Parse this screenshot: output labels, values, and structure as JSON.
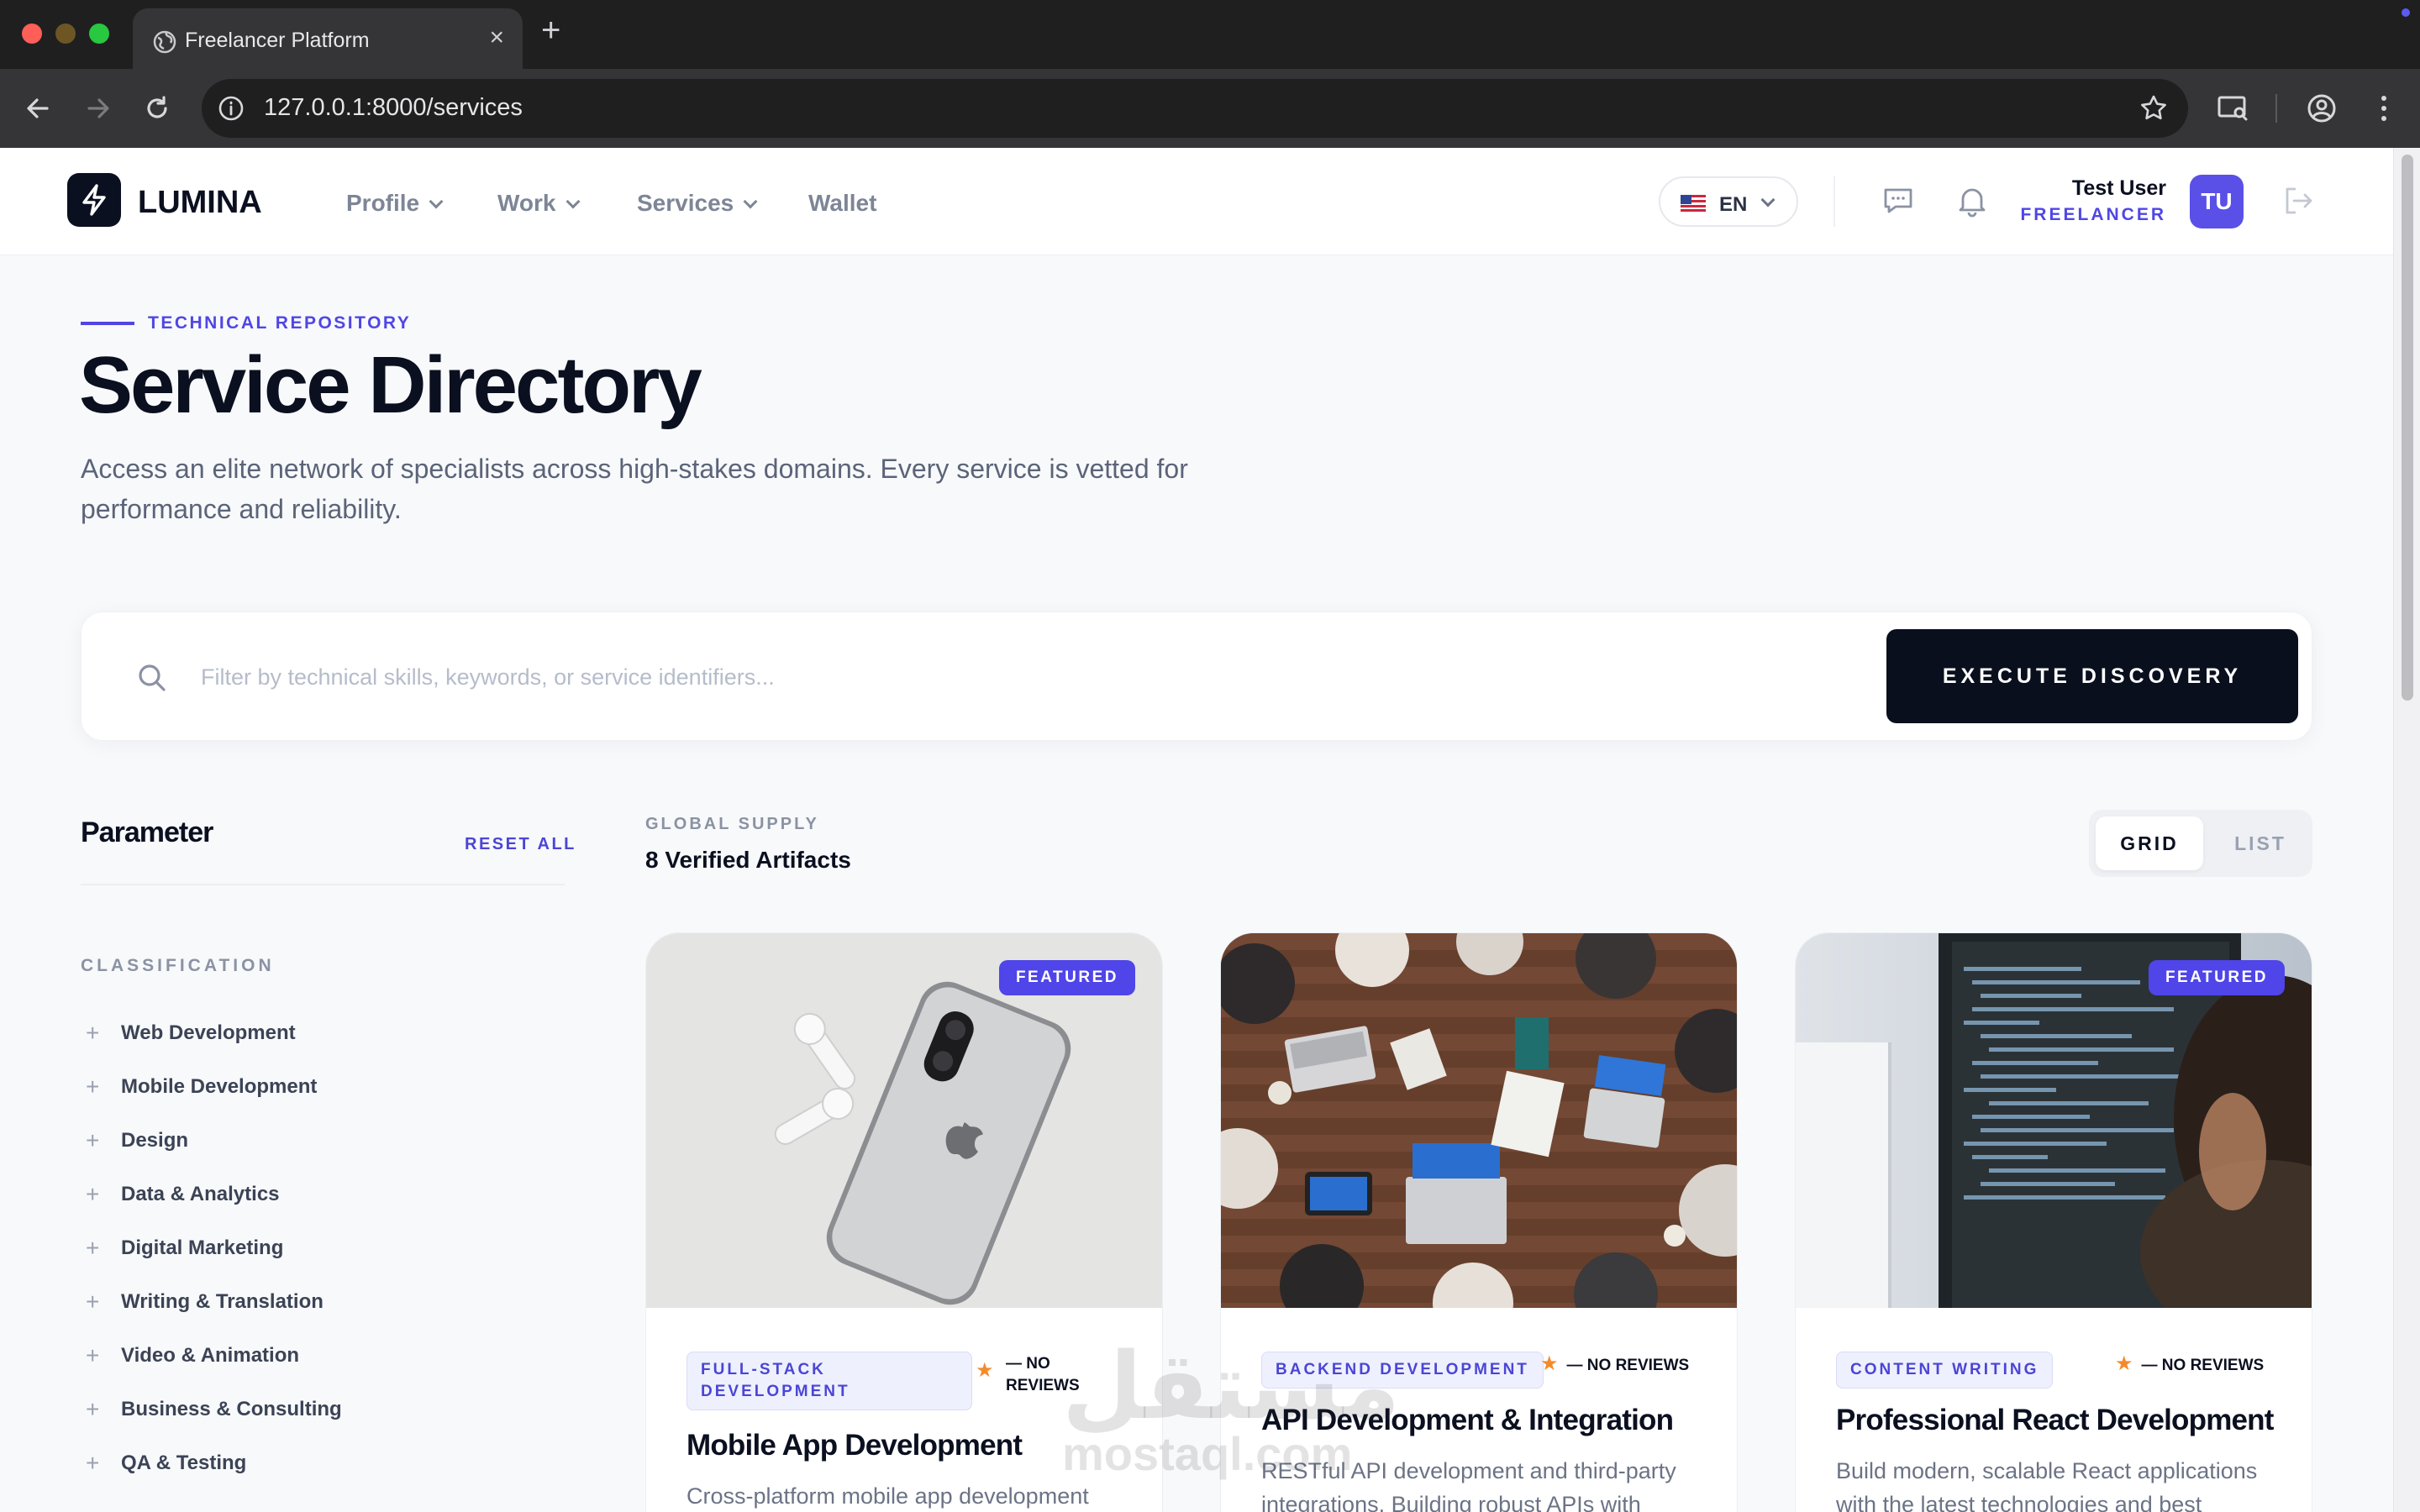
{
  "browser": {
    "tab_title": "Freelancer Platform",
    "url": "127.0.0.1:8000/services",
    "new_tab_label": "+",
    "close_label": "×"
  },
  "header": {
    "logo": "LUMINA",
    "nav": [
      {
        "label": "Profile",
        "has_menu": true
      },
      {
        "label": "Work",
        "has_menu": true
      },
      {
        "label": "Services",
        "has_menu": true
      },
      {
        "label": "Wallet",
        "has_menu": false
      }
    ],
    "language": "EN",
    "user": {
      "name": "Test User",
      "role": "FREELANCER",
      "initials": "TU"
    }
  },
  "hero": {
    "eyebrow": "TECHNICAL REPOSITORY",
    "title": "Service Directory",
    "description": "Access an elite network of specialists across high-stakes domains. Every service is vetted for performance and reliability."
  },
  "search": {
    "placeholder": "Filter by technical skills, keywords, or service identifiers...",
    "value": "",
    "button": "EXECUTE DISCOVERY"
  },
  "sidebar": {
    "title": "Parameter",
    "reset": "RESET ALL",
    "section": "CLASSIFICATION",
    "categories": [
      "Web Development",
      "Mobile Development",
      "Design",
      "Data & Analytics",
      "Digital Marketing",
      "Writing & Translation",
      "Video & Animation",
      "Business & Consulting",
      "QA & Testing"
    ]
  },
  "results": {
    "eyebrow": "GLOBAL SUPPLY",
    "count": "8 Verified Artifacts",
    "views": {
      "grid": "GRID",
      "list": "LIST",
      "active": "grid"
    }
  },
  "cards": [
    {
      "featured": true,
      "badge": "FEATURED",
      "tag_line1": "FULL-STACK",
      "tag_line2": "DEVELOPMENT",
      "rating_line1": "— NO",
      "rating_line2": "REVIEWS",
      "title": "Mobile App Development",
      "description": "Cross-platform mobile app development",
      "image": "smartphone-earbuds-photo"
    },
    {
      "featured": false,
      "badge": "",
      "tag": "BACKEND DEVELOPMENT",
      "rating": "— NO REVIEWS",
      "title": "API Development & Integration",
      "description": "RESTful API development and third-party integrations. Building robust APIs with",
      "image": "team-meeting-laptops-photo"
    },
    {
      "featured": true,
      "badge": "FEATURED",
      "tag": "CONTENT WRITING",
      "rating": "— NO REVIEWS",
      "title": "Professional React Development",
      "description": "Build modern, scalable React applications with the latest technologies and best",
      "image": "developer-code-monitor-photo"
    }
  ],
  "watermark": {
    "arabic": "مستقل",
    "latin": "mostaql.com"
  },
  "colors": {
    "accent": "#5046e5",
    "dark": "#0b1020",
    "star": "#f58a2b"
  }
}
